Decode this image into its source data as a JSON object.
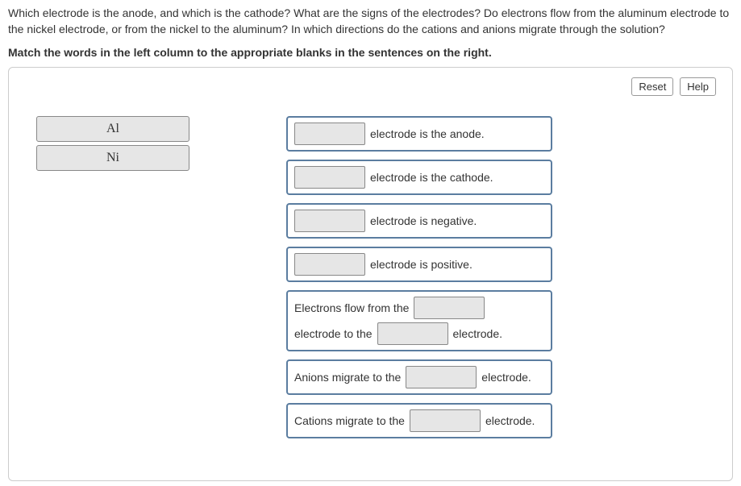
{
  "question": {
    "paragraph": "Which electrode is the anode, and which is the cathode? What are the signs of the electrodes? Do electrons flow from the aluminum electrode to the nickel electrode, or from the nickel to the aluminum? In which directions do the cations and anions migrate through the solution?",
    "instruction": "Match the words in the left column to the appropriate blanks in the sentences on the right."
  },
  "toolbar": {
    "reset_label": "Reset",
    "help_label": "Help"
  },
  "word_bank": {
    "items": [
      "Al",
      "Ni"
    ]
  },
  "sentences": {
    "s1_after": "electrode is the anode.",
    "s2_after": "electrode is the cathode.",
    "s3_after": "electrode is negative.",
    "s4_after": "electrode is positive.",
    "s5_part1": "Electrons flow from the",
    "s5_part2": "electrode to the",
    "s5_part3": "electrode.",
    "s6_part1": "Anions migrate to the",
    "s6_part2": "electrode.",
    "s7_part1": "Cations migrate to the",
    "s7_part2": "electrode."
  }
}
